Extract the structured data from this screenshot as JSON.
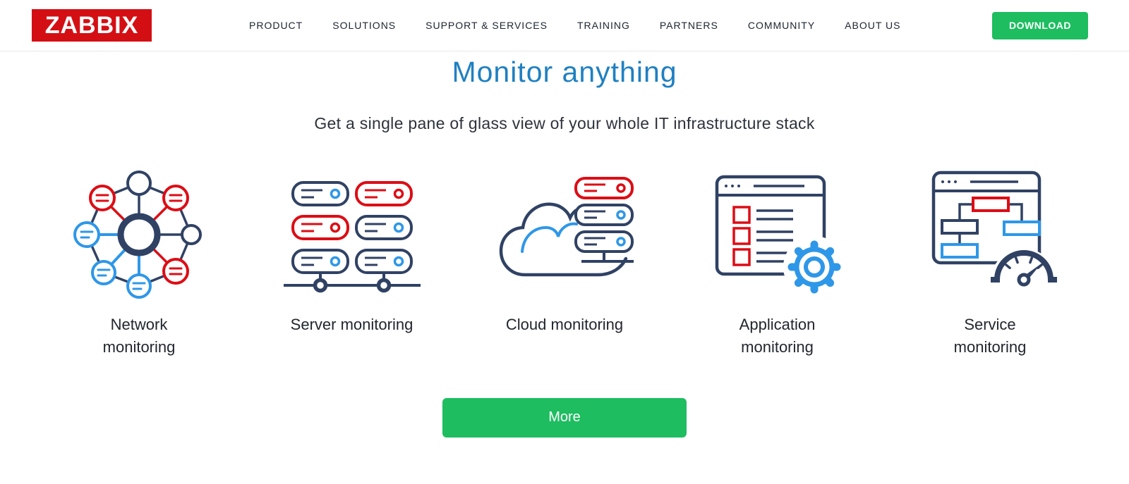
{
  "header": {
    "logo_text": "ZABBIX",
    "nav": [
      "PRODUCT",
      "SOLUTIONS",
      "SUPPORT & SERVICES",
      "TRAINING",
      "PARTNERS",
      "COMMUNITY",
      "ABOUT US"
    ],
    "download_label": "DOWNLOAD"
  },
  "hero": {
    "title": "Monitor anything",
    "subtitle": "Get a single pane of glass view of your whole IT infrastructure stack",
    "more_label": "More"
  },
  "features": [
    {
      "label": "Network monitoring",
      "icon": "network-monitoring-icon"
    },
    {
      "label": "Server monitoring",
      "icon": "server-monitoring-icon"
    },
    {
      "label": "Cloud monitoring",
      "icon": "cloud-monitoring-icon"
    },
    {
      "label": "Application monitoring",
      "icon": "application-monitoring-icon"
    },
    {
      "label": "Service monitoring",
      "icon": "service-monitoring-icon"
    }
  ],
  "colors": {
    "brand_red": "#d40f14",
    "heading_blue": "#1f80c1",
    "button_green": "#1dbd60",
    "icon_navy": "#304264",
    "icon_red": "#dd0d15",
    "icon_blue": "#2e97e8",
    "nav_text": "#1c2430",
    "body_text": "#2d323b"
  }
}
